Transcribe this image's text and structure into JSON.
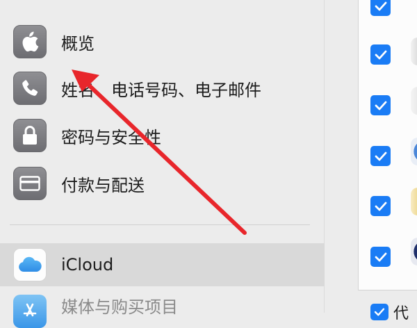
{
  "sidebar": {
    "items": [
      {
        "label": "概览",
        "icon": "apple-icon"
      },
      {
        "label": "姓名、电话号码、电子邮件",
        "icon": "phone-icon"
      },
      {
        "label": "密码与安全性",
        "icon": "lock-icon"
      },
      {
        "label": "付款与配送",
        "icon": "credit-card-icon"
      }
    ],
    "secondary_items": [
      {
        "label": "iCloud",
        "icon": "icloud-icon",
        "selected": true
      },
      {
        "label": "媒体与购买项目",
        "icon": "app-store-icon"
      }
    ]
  },
  "content": {
    "checkbox_rows_checked": [
      true,
      true,
      true,
      true,
      true,
      true
    ],
    "bottom_row_label": "代"
  },
  "colors": {
    "accent": "#1a7cf5",
    "arrow": "#e8262b",
    "selected_row": "#d9d9d9",
    "sidebar_bg": "#ececec"
  }
}
